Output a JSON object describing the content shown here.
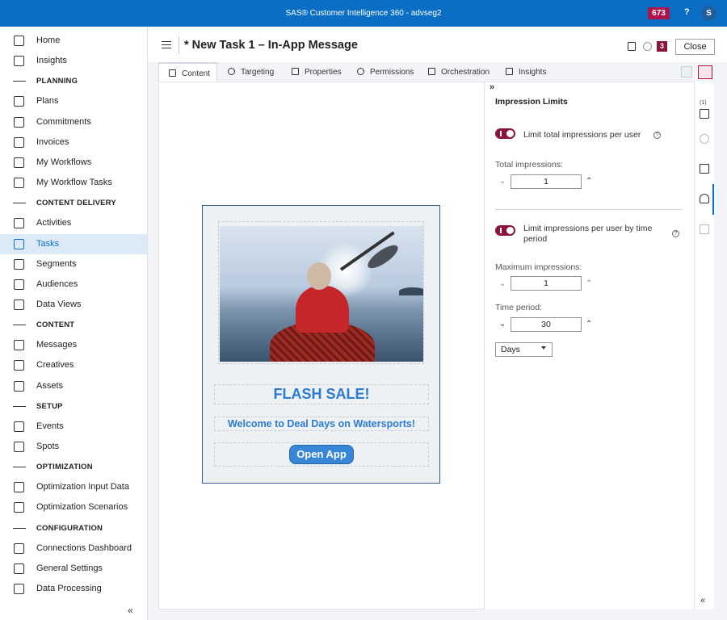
{
  "app": {
    "title": "SAS® Customer Intelligence 360 - advseg2",
    "notification_count": "673",
    "help_label": "?",
    "user_initial": "S"
  },
  "sidebar": {
    "items": [
      {
        "type": "item",
        "label": "Home",
        "icon": "home-icon"
      },
      {
        "type": "item",
        "label": "Insights",
        "icon": "insights-icon"
      },
      {
        "type": "section",
        "label": "PLANNING"
      },
      {
        "type": "item",
        "label": "Plans",
        "icon": "plans-icon"
      },
      {
        "type": "item",
        "label": "Commitments",
        "icon": "commitments-icon"
      },
      {
        "type": "item",
        "label": "Invoices",
        "icon": "invoices-icon"
      },
      {
        "type": "item",
        "label": "My Workflows",
        "icon": "workflows-icon"
      },
      {
        "type": "item",
        "label": "My Workflow Tasks",
        "icon": "workflow-tasks-icon"
      },
      {
        "type": "section",
        "label": "CONTENT DELIVERY"
      },
      {
        "type": "item",
        "label": "Activities",
        "icon": "activities-icon"
      },
      {
        "type": "item",
        "label": "Tasks",
        "icon": "tasks-icon",
        "active": true
      },
      {
        "type": "item",
        "label": "Segments",
        "icon": "segments-icon"
      },
      {
        "type": "item",
        "label": "Audiences",
        "icon": "audiences-icon"
      },
      {
        "type": "item",
        "label": "Data Views",
        "icon": "data-views-icon"
      },
      {
        "type": "section",
        "label": "CONTENT"
      },
      {
        "type": "item",
        "label": "Messages",
        "icon": "messages-icon"
      },
      {
        "type": "item",
        "label": "Creatives",
        "icon": "creatives-icon"
      },
      {
        "type": "item",
        "label": "Assets",
        "icon": "assets-icon"
      },
      {
        "type": "section",
        "label": "SETUP"
      },
      {
        "type": "item",
        "label": "Events",
        "icon": "events-icon"
      },
      {
        "type": "item",
        "label": "Spots",
        "icon": "spots-icon"
      },
      {
        "type": "section",
        "label": "OPTIMIZATION"
      },
      {
        "type": "item",
        "label": "Optimization Input Data",
        "icon": "optimization-input-icon"
      },
      {
        "type": "item",
        "label": "Optimization Scenarios",
        "icon": "optimization-scenarios-icon"
      },
      {
        "type": "section",
        "label": "CONFIGURATION"
      },
      {
        "type": "item",
        "label": "Connections Dashboard",
        "icon": "connections-icon"
      },
      {
        "type": "item",
        "label": "General Settings",
        "icon": "settings-wrench-icon"
      },
      {
        "type": "item",
        "label": "Data Processing",
        "icon": "data-processing-icon"
      }
    ],
    "collapse_label": "«"
  },
  "header": {
    "title": "* New Task 1 – In-App Message",
    "badge": "3",
    "close_label": "Close"
  },
  "tabs": [
    {
      "label": "Content",
      "icon": "content-icon",
      "active": true
    },
    {
      "label": "Targeting",
      "icon": "targeting-icon"
    },
    {
      "label": "Properties",
      "icon": "properties-icon"
    },
    {
      "label": "Permissions",
      "icon": "permissions-icon"
    },
    {
      "label": "Orchestration",
      "icon": "orchestration-icon"
    },
    {
      "label": "Insights",
      "icon": "insights-tab-icon"
    }
  ],
  "message": {
    "headline": "FLASH SALE!",
    "subheadline": "Welcome to Deal Days on Watersports!",
    "button_label": "Open App"
  },
  "panel": {
    "expand_label": "»",
    "title": "Impression Limits",
    "limit_total_label": "Limit total impressions per user",
    "limit_total_on": true,
    "total_impressions_label": "Total impressions:",
    "total_impressions_value": "1",
    "limit_time_label": "Limit impressions per user by time period",
    "limit_time_on": true,
    "max_impressions_label": "Maximum impressions:",
    "max_impressions_value": "1",
    "time_period_label": "Time period:",
    "time_period_value": "30",
    "period_unit": "Days",
    "info_glyph": "?"
  },
  "rail": {
    "count_label": "(1)",
    "collapse_label": "«"
  },
  "colors": {
    "brand_blue": "#0a6fc4",
    "accent_maroon": "#8a1538",
    "message_text": "#2a7bd1"
  }
}
